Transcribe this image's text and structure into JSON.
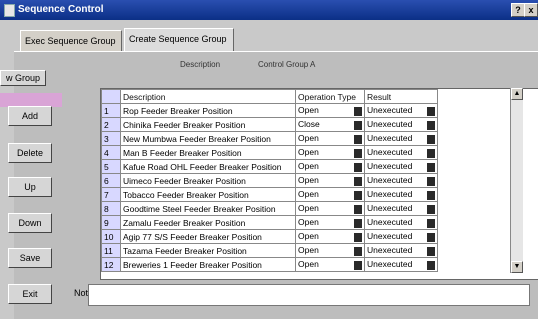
{
  "window": {
    "title": "Sequence Control",
    "help_glyph": "?",
    "close_glyph": "x"
  },
  "tabs": [
    {
      "label": "Exec Sequence Group"
    },
    {
      "label": "Create Sequence Group"
    }
  ],
  "background_labels": {
    "description": "Description",
    "control_group": "Control Group A"
  },
  "side_buttons": {
    "group_label": "w Group",
    "add": "Add",
    "delete": "Delete",
    "up": "Up",
    "down": "Down",
    "save": "Save",
    "exit": "Exit"
  },
  "table": {
    "headers": {
      "description": "Description",
      "operation_type": "Operation Type",
      "result": "Result"
    },
    "rows": [
      {
        "num": "1",
        "description": "Rop Feeder Breaker Position",
        "operation": "Open",
        "result": "Unexecuted"
      },
      {
        "num": "2",
        "description": "Chinika Feeder Breaker Position",
        "operation": "Close",
        "result": "Unexecuted"
      },
      {
        "num": "3",
        "description": "New Mumbwa Feeder Breaker Position",
        "operation": "Open",
        "result": "Unexecuted"
      },
      {
        "num": "4",
        "description": "Man B Feeder Breaker Position",
        "operation": "Open",
        "result": "Unexecuted"
      },
      {
        "num": "5",
        "description": "Kafue Road OHL Feeder Breaker Position",
        "operation": "Open",
        "result": "Unexecuted"
      },
      {
        "num": "6",
        "description": "Uimeco Feeder Breaker Position",
        "operation": "Open",
        "result": "Unexecuted"
      },
      {
        "num": "7",
        "description": "Tobacco Feeder Breaker Position",
        "operation": "Open",
        "result": "Unexecuted"
      },
      {
        "num": "8",
        "description": "Goodtime Steel Feeder Breaker Position",
        "operation": "Open",
        "result": "Unexecuted"
      },
      {
        "num": "9",
        "description": "Zamalu Feeder Breaker Position",
        "operation": "Open",
        "result": "Unexecuted"
      },
      {
        "num": "10",
        "description": "Agip 77 S/S Feeder Breaker Position",
        "operation": "Open",
        "result": "Unexecuted"
      },
      {
        "num": "11",
        "description": "Tazama Feeder Breaker Position",
        "operation": "Open",
        "result": "Unexecuted"
      },
      {
        "num": "12",
        "description": "Breweries 1 Feeder Breaker Position",
        "operation": "Open",
        "result": "Unexecuted"
      }
    ]
  },
  "note": {
    "label": "Note:",
    "value": ""
  }
}
